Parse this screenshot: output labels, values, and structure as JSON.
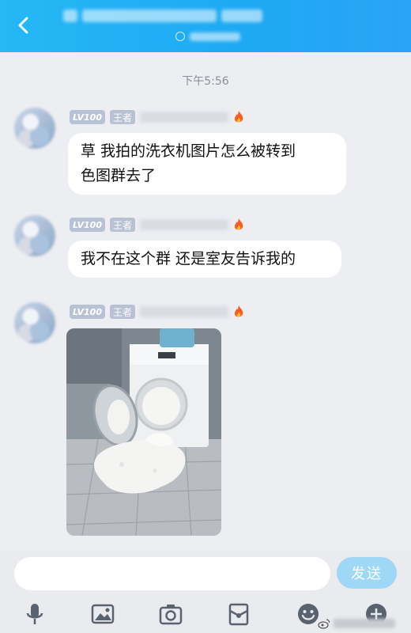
{
  "header": {
    "back_icon": "chevron-left-icon",
    "title_prefix": "",
    "title_blurred": true
  },
  "timestamp": "下午5:56",
  "messages": [
    {
      "level": "LV100",
      "rank": "王者",
      "name_blurred": true,
      "badge_icon": "fire-icon",
      "type": "text",
      "text_lines": [
        "草 我拍的洗衣机图片怎么被转到",
        "色图群去了"
      ]
    },
    {
      "level": "LV100",
      "rank": "王者",
      "name_blurred": true,
      "badge_icon": "fire-icon",
      "type": "text",
      "text_lines": [
        "我不在这个群 还是室友告诉我的"
      ]
    },
    {
      "level": "LV100",
      "rank": "王者",
      "name_blurred": true,
      "badge_icon": "fire-icon",
      "type": "image",
      "image_description": "washing-machine-overflow-photo"
    }
  ],
  "input": {
    "value": "",
    "placeholder": ""
  },
  "send_label": "发送",
  "toolbar_icons": [
    "microphone-icon",
    "image-icon",
    "camera-icon",
    "red-packet-icon",
    "emoji-icon",
    "plus-icon"
  ],
  "colors": {
    "header": "#1ea9f3",
    "badge": "#b9c2d4",
    "send_button": "#9fd8f7",
    "background": "#eceef2"
  }
}
